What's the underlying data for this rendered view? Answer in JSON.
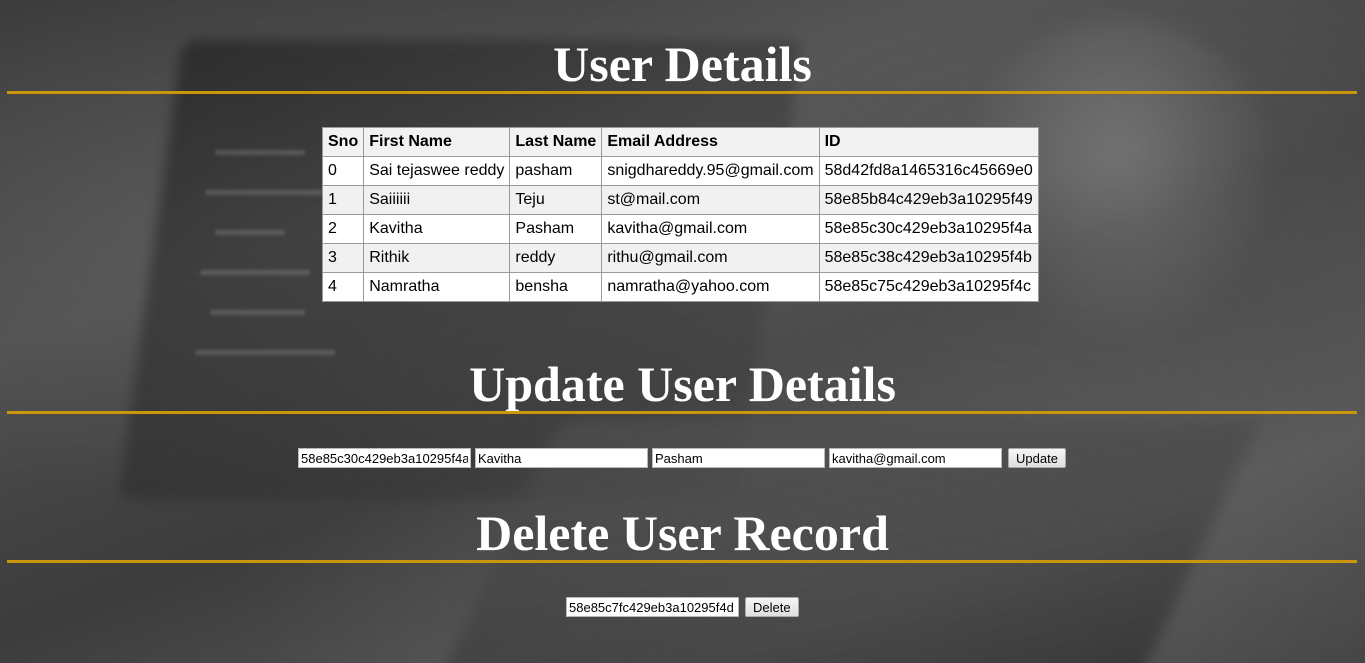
{
  "sections": {
    "details_title": "User Details",
    "update_title": "Update User Details",
    "delete_title": "Delete User Record"
  },
  "table": {
    "headers": [
      "Sno",
      "First Name",
      "Last Name",
      "Email Address",
      "ID"
    ],
    "rows": [
      [
        "0",
        "Sai tejaswee reddy",
        "pasham",
        "snigdhareddy.95@gmail.com",
        "58d42fd8a1465316c45669e0"
      ],
      [
        "1",
        "Saiiiiii",
        "Teju",
        "st@mail.com",
        "58e85b84c429eb3a10295f49"
      ],
      [
        "2",
        "Kavitha",
        "Pasham",
        "kavitha@gmail.com",
        "58e85c30c429eb3a10295f4a"
      ],
      [
        "3",
        "Rithik",
        "reddy",
        "rithu@gmail.com",
        "58e85c38c429eb3a10295f4b"
      ],
      [
        "4",
        "Namratha",
        "bensha",
        "namratha@yahoo.com",
        "58e85c75c429eb3a10295f4c"
      ]
    ]
  },
  "update_form": {
    "id_value": "58e85c30c429eb3a10295f4a",
    "first_name_value": "Kavitha",
    "last_name_value": "Pasham",
    "email_value": "kavitha@gmail.com",
    "button_label": "Update"
  },
  "delete_form": {
    "id_value": "58e85c7fc429eb3a10295f4d",
    "button_label": "Delete"
  },
  "colors": {
    "accent_rule": "#c9960c",
    "title_text": "#ffffff"
  }
}
